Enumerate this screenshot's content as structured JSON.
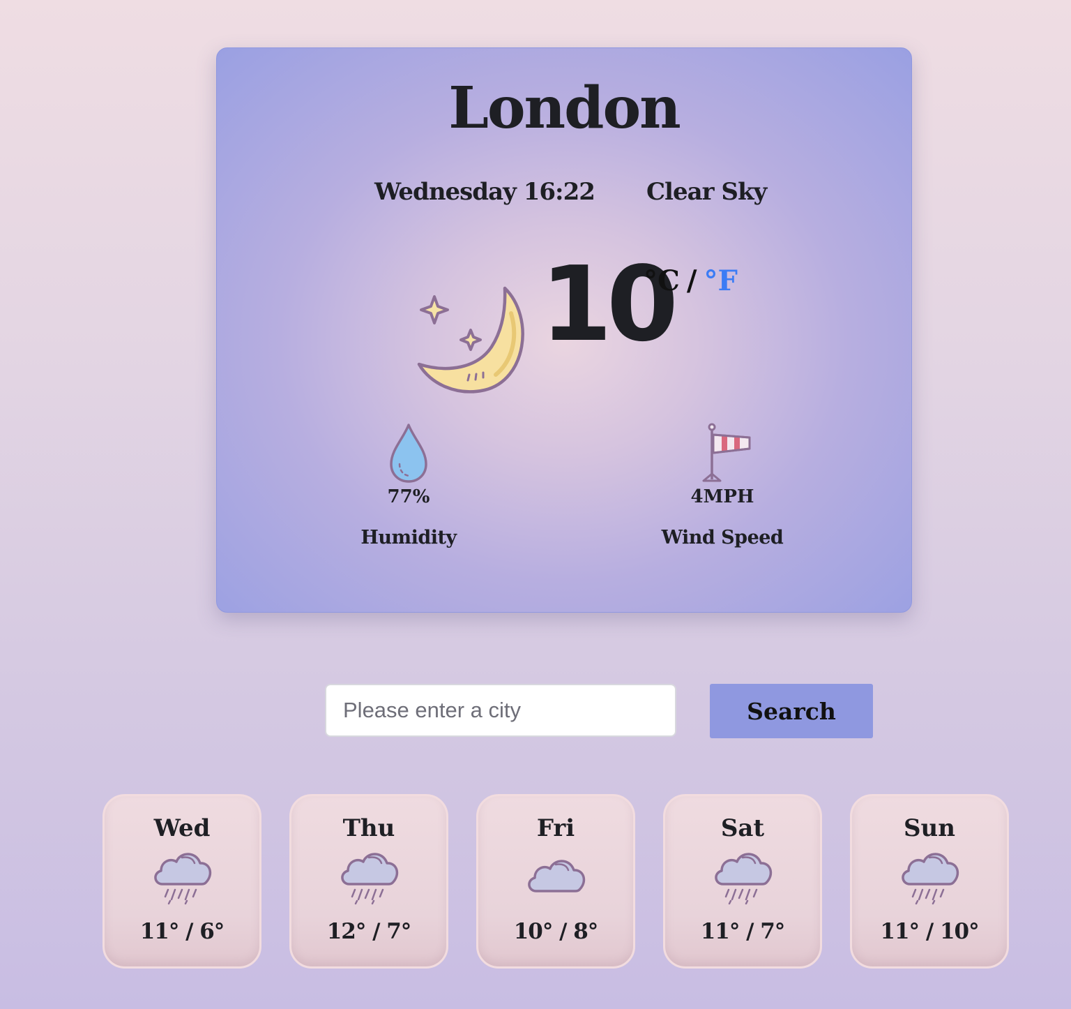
{
  "current": {
    "city": "London",
    "day_time": "Wednesday 16:22",
    "condition": "Clear Sky",
    "condition_icon": "moon-stars-icon",
    "temperature": "10",
    "unit_celsius": "°C",
    "unit_separator": "/",
    "unit_fahrenheit": "°F",
    "humidity": {
      "value": "77%",
      "label": "Humidity",
      "icon": "water-drop-icon"
    },
    "wind": {
      "value": "4MPH",
      "label": "Wind Speed",
      "icon": "windsock-icon"
    }
  },
  "search": {
    "placeholder": "Please enter a city",
    "value": "",
    "button_label": "Search"
  },
  "forecast": [
    {
      "day": "Wed",
      "temp": "11° / 6°",
      "icon": "rain-cloud-icon"
    },
    {
      "day": "Thu",
      "temp": "12° / 7°",
      "icon": "rain-cloud-icon"
    },
    {
      "day": "Fri",
      "temp": "10° / 8°",
      "icon": "cloud-icon"
    },
    {
      "day": "Sat",
      "temp": "11° / 7°",
      "icon": "rain-cloud-icon"
    },
    {
      "day": "Sun",
      "temp": "11° / 10°",
      "icon": "rain-cloud-icon"
    }
  ],
  "colors": {
    "card_border": "#8f98e0",
    "button_bg": "#8f98e0",
    "fahrenheit_link": "#3b7cf5",
    "forecast_card_bg": "#efdbe0",
    "forecast_card_border": "#f2dcdf",
    "text": "#1e1f24"
  }
}
